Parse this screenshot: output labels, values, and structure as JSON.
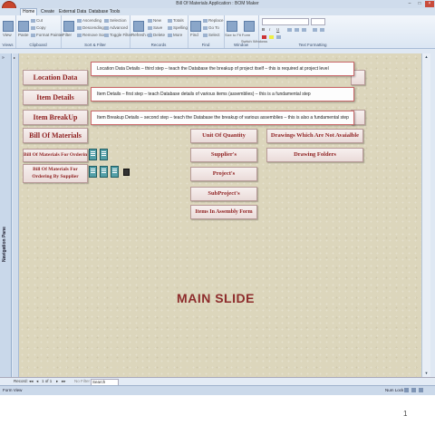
{
  "window": {
    "title": "Bill Of Materials Application : BOM Maker",
    "controls": [
      "–",
      "□",
      "×"
    ]
  },
  "ribbon": {
    "tabs": [
      "Home",
      "Create",
      "External Data",
      "Database Tools"
    ],
    "groups": [
      {
        "label": "Views",
        "items": [
          "View"
        ]
      },
      {
        "label": "Clipboard",
        "items": [
          "Paste",
          "Cut",
          "Copy",
          "Format Painter"
        ]
      },
      {
        "label": "Sort & Filter",
        "items": [
          "Filter",
          "Ascending",
          "Descending",
          "Remove Sort",
          "Selection",
          "Advanced",
          "Toggle Filter"
        ]
      },
      {
        "label": "Records",
        "items": [
          "Refresh All",
          "New",
          "Save",
          "Delete",
          "Totals",
          "Spelling",
          "More"
        ]
      },
      {
        "label": "Find",
        "items": [
          "Find",
          "Replace",
          "Go To",
          "Select"
        ]
      },
      {
        "label": "Window",
        "items": [
          "Size to Fit Form",
          "Switch Windows"
        ]
      },
      {
        "label": "Text Formatting",
        "items": [
          "B",
          "I",
          "U"
        ]
      }
    ]
  },
  "nav_pane": {
    "label": "Navigation Pane"
  },
  "buttons": {
    "location_data": "Location Data",
    "item_details": "Item Details",
    "item_breakup": "Item BreakUp",
    "bill_of_materials": "Bill Of Materials",
    "bom_for_ordering": "Bill Of Materials For Ordering",
    "bom_for_ordering_by_supplier": "Bill Of Materials For Ordering By Supplier",
    "unit_of_quantity": "Unit Of Quantity",
    "suppliers": "Supplier's",
    "projects": "Project's",
    "subprojects": "SubProject's",
    "items_in_assembly_form": "Items In Assembly Form",
    "drawings_not_available": "Drawings Which Are Not Avaialble",
    "drawing_folders": "Drawing Folders"
  },
  "tooltips": {
    "location": "Location Data Details – third step – teach the Database the breakup of project itself – this is required at project level",
    "item_details": "Item Details – first step – teach Database details of various items (assemblies) – this is a fundamental step",
    "item_breakup": "Item Breakup Details – second step – teach the Database the breakup of various assemblies – this is also a fundamental step"
  },
  "slide_title": "MAIN SLIDE",
  "record_nav": {
    "record_label": "Record:",
    "position": "1 of 1",
    "filter": "No Filter",
    "search": "Search"
  },
  "status": {
    "left": "Form View",
    "right": "Num Lock"
  },
  "page_number": "1"
}
